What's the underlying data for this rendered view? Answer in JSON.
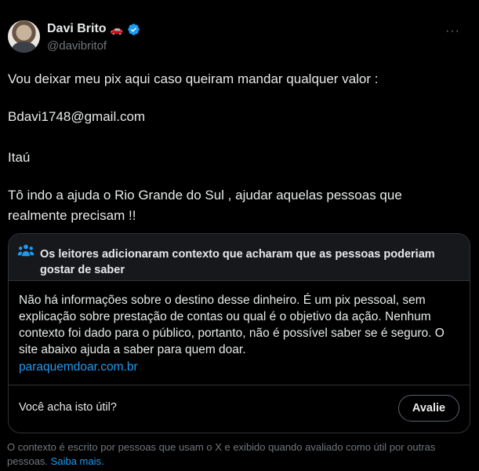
{
  "author": {
    "name": "Davi Brito",
    "emoji": "🚗",
    "handle": "@davibritof"
  },
  "tweet": {
    "line1": "Vou deixar meu pix aqui caso queiram mandar qualquer valor  :",
    "line2": "Bdavi1748@gmail.com",
    "line3": "Itaú",
    "line4": " Tô indo a ajuda o Rio Grande do Sul , ajudar aquelas pessoas que realmente precisam !!"
  },
  "community_note": {
    "title": "Os leitores adicionaram contexto que acharam que as pessoas poderiam gostar de saber",
    "body": "Não há informações sobre o destino desse dinheiro. É um pix pessoal, sem explicação sobre prestação de contas ou qual é o objetivo da ação. Nenhum contexto foi dado para o público, portanto, não é possível saber se é seguro. O site abaixo ajuda a saber para quem doar.",
    "link": "paraquemdoar.com.br",
    "question": "Você acha isto útil?",
    "rate_label": "Avalie"
  },
  "footnote": {
    "text": "O contexto é escrito por pessoas que usam o X e exibido quando avaliado como útil por outras pessoas.",
    "learn_more": "Saiba mais."
  },
  "icons": {
    "verified": "verified-badge-icon",
    "more": "more-horizontal-icon",
    "people": "people-icon"
  },
  "colors": {
    "background": "#000000",
    "text": "#e7e9ea",
    "muted": "#71767b",
    "link": "#1d9bf0",
    "border": "#2f3336"
  }
}
